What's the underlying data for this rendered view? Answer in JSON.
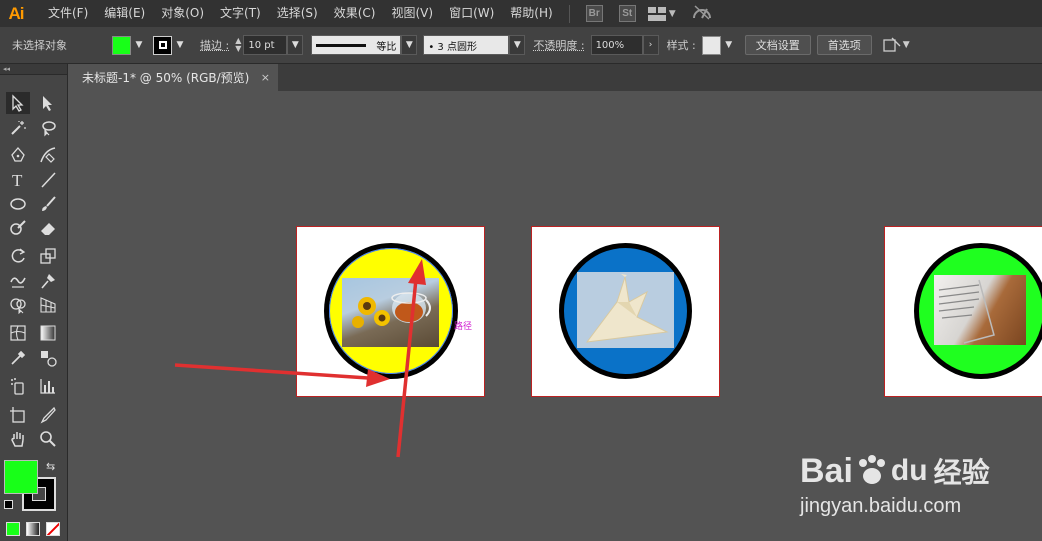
{
  "app": {
    "logo": "Ai"
  },
  "menu": [
    "文件(F)",
    "编辑(E)",
    "对象(O)",
    "文字(T)",
    "选择(S)",
    "效果(C)",
    "视图(V)",
    "窗口(W)",
    "帮助(H)"
  ],
  "menubar_badges": {
    "bridge": "Br",
    "stock": "St"
  },
  "control": {
    "selection_status": "未选择对象",
    "stroke_label": "描边 :",
    "stroke_weight": "10 pt",
    "profile_label": "等比",
    "brush_value": "• 3 点圆形",
    "opacity_label": "不透明度 :",
    "opacity_value": "100%",
    "style_label": "样式 :",
    "doc_setup": "文档设置",
    "preferences": "首选项",
    "colors": {
      "fill": "#18ff18",
      "stroke": "#000000"
    }
  },
  "document": {
    "tab_title": "未标题-1* @ 50% (RGB/预览)",
    "close_symbol": "×"
  },
  "artwork": {
    "path_label": "路径",
    "circle_colors": [
      "#ffff00",
      "#0a72c8",
      "#1fff1f"
    ]
  },
  "toolbar_colors": {
    "fill": "#18ff18",
    "stroke": "#000000"
  },
  "watermark": {
    "brand": "Bai",
    "brand2": "du",
    "cn": "经验",
    "url": "jingyan.baidu.com"
  }
}
